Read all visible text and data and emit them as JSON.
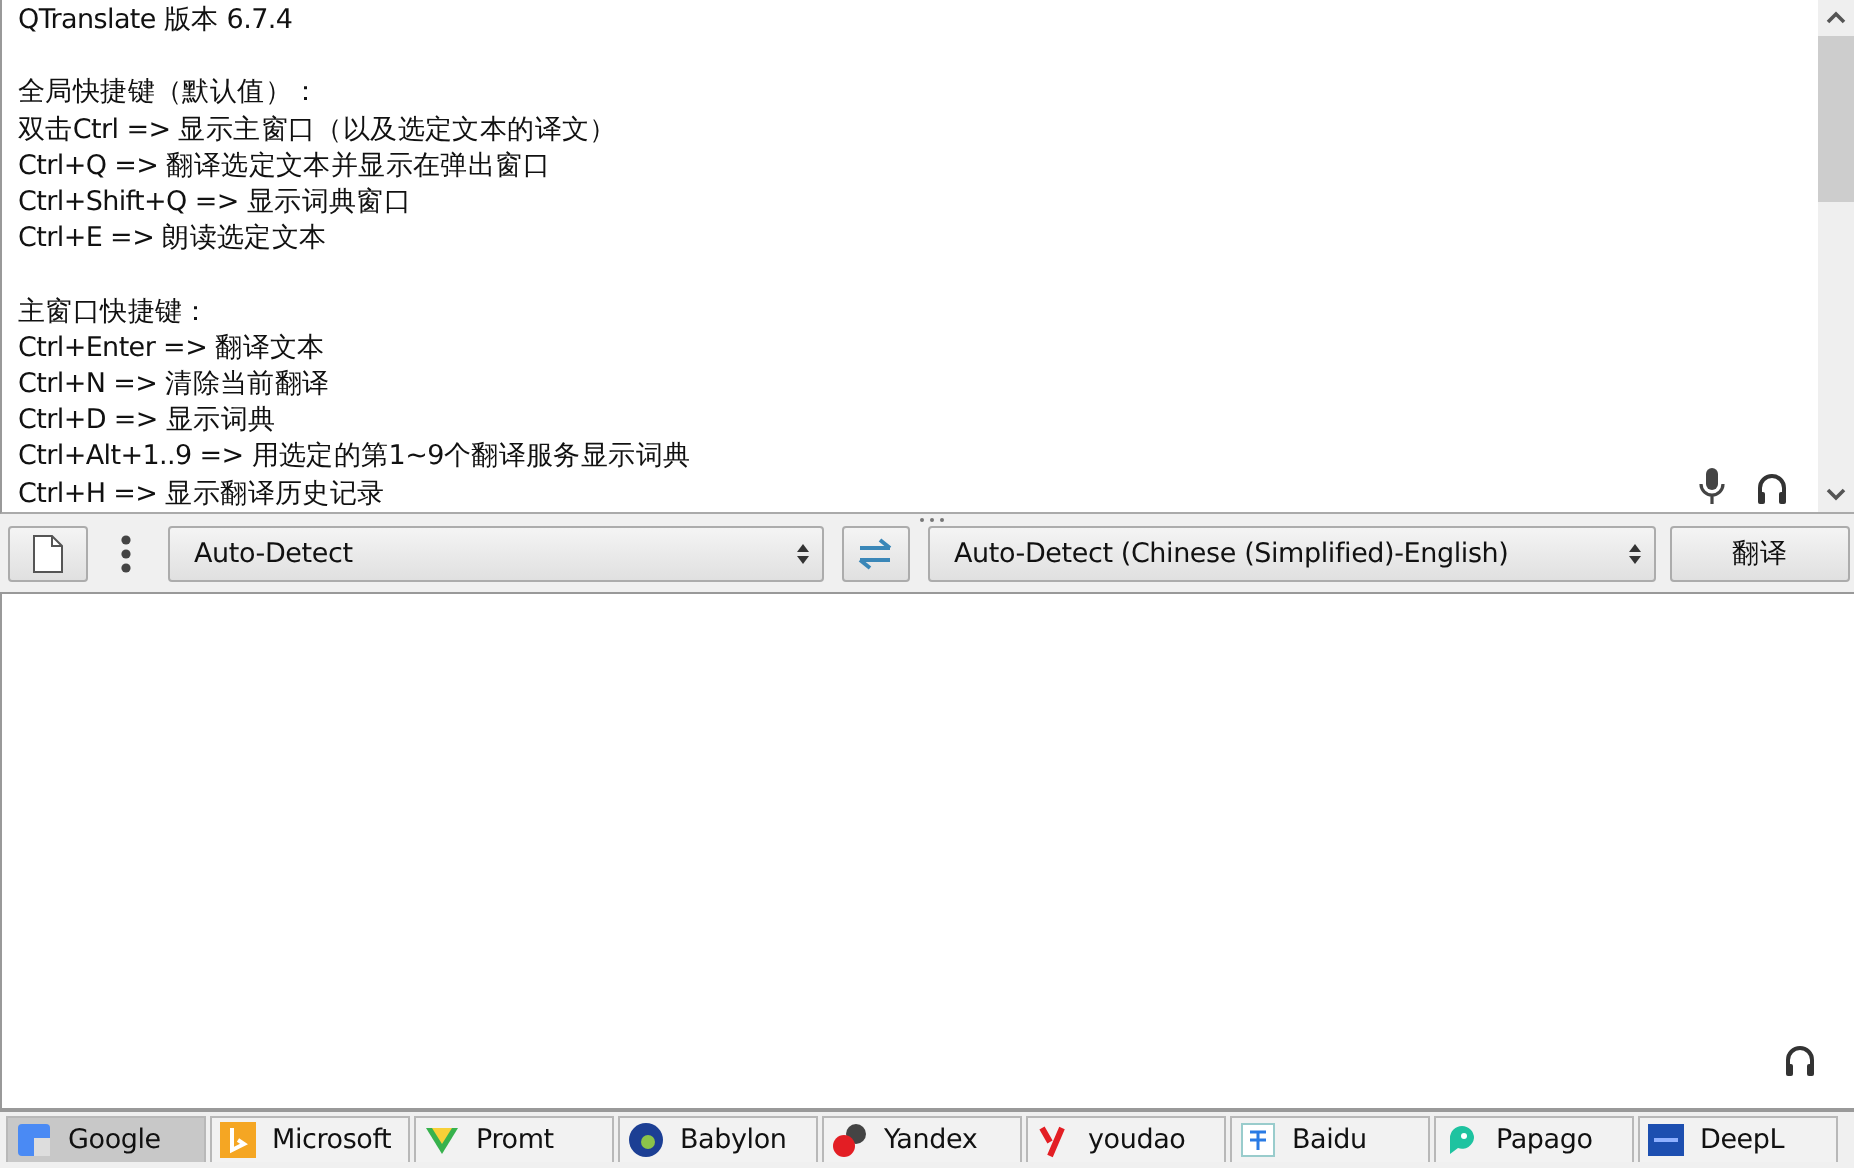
{
  "source_text": {
    "paragraphs": [
      {
        "lines": [
          "QTranslate 版本 6.7.4"
        ]
      },
      {
        "lines": [
          "全局快捷键（默认值）：",
          "双击Ctrl => 显示主窗口（以及选定文本的译文）",
          "Ctrl+Q => 翻译选定文本并显示在弹出窗口",
          "Ctrl+Shift+Q => 显示词典窗口",
          "Ctrl+E => 朗读选定文本"
        ]
      },
      {
        "lines": [
          "主窗口快捷键：",
          "Ctrl+Enter => 翻译文本",
          "Ctrl+N => 清除当前翻译",
          "Ctrl+D => 显示词典",
          "Ctrl+Alt+1..9 => 用选定的第1~9个翻译服务显示词典",
          "Ctrl+H => 显示翻译历史记录"
        ]
      }
    ]
  },
  "toolbar": {
    "source_language": "Auto-Detect",
    "target_language": "Auto-Detect (Chinese (Simplified)-English)",
    "translate_button": "翻译"
  },
  "services": [
    {
      "label": "Google",
      "kind": "google",
      "selected": true
    },
    {
      "label": "Microsoft",
      "kind": "microsoft",
      "selected": false
    },
    {
      "label": "Promt",
      "kind": "promt",
      "selected": false
    },
    {
      "label": "Babylon",
      "kind": "babylon",
      "selected": false
    },
    {
      "label": "Yandex",
      "kind": "yandex",
      "selected": false
    },
    {
      "label": "youdao",
      "kind": "youdao",
      "selected": false
    },
    {
      "label": "Baidu",
      "kind": "baidu",
      "selected": false
    },
    {
      "label": "Papago",
      "kind": "papago",
      "selected": false
    },
    {
      "label": "DeepL",
      "kind": "deepl",
      "selected": false
    }
  ]
}
